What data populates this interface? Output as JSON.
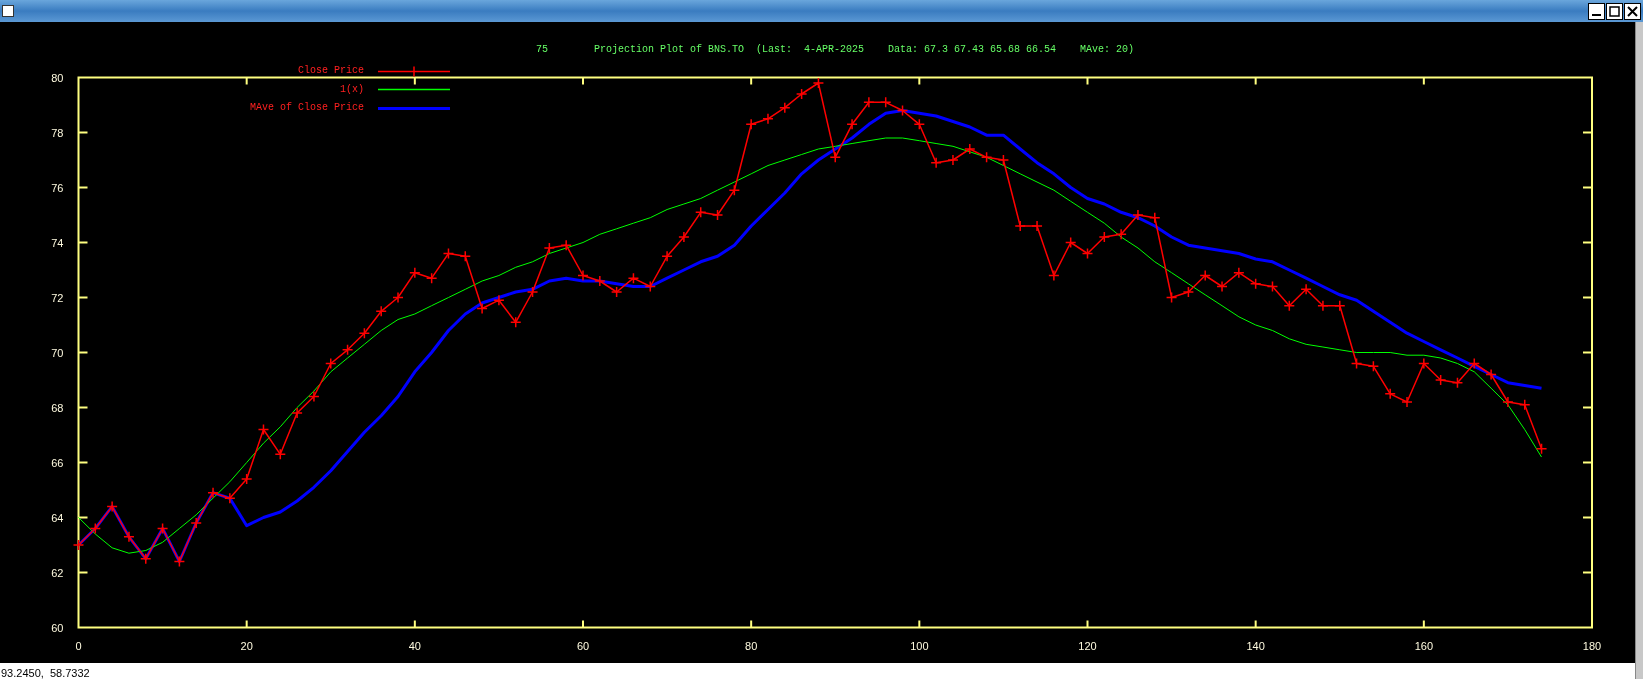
{
  "plot_number": "75",
  "chart_data": {
    "type": "line",
    "title": "Projection Plot of BNS.TO  (Last:  4-APR-2025    Data: 67.3 67.43 65.68 66.54    MAve: 20)",
    "x": [
      0,
      2,
      4,
      6,
      8,
      10,
      12,
      14,
      16,
      18,
      20,
      22,
      24,
      26,
      28,
      30,
      32,
      34,
      36,
      38,
      40,
      42,
      44,
      46,
      48,
      50,
      52,
      54,
      56,
      58,
      60,
      62,
      64,
      66,
      68,
      70,
      72,
      74,
      76,
      78,
      80,
      82,
      84,
      86,
      88,
      90,
      92,
      94,
      96,
      98,
      100,
      102,
      104,
      106,
      108,
      110,
      112,
      114,
      116,
      118,
      120,
      122,
      124,
      126,
      128,
      130,
      132,
      134,
      136,
      138,
      140,
      142,
      144,
      146,
      148,
      150,
      152,
      154,
      156,
      158,
      160,
      162,
      164,
      166,
      168,
      170,
      172,
      174
    ],
    "series": [
      {
        "name": "Close Price",
        "color": "#ff0000",
        "marker": "plus",
        "values": [
          63.0,
          63.6,
          64.4,
          63.3,
          62.5,
          63.6,
          62.4,
          63.8,
          64.9,
          64.7,
          65.4,
          67.2,
          66.3,
          67.8,
          68.4,
          69.6,
          70.1,
          70.7,
          71.5,
          72.0,
          72.9,
          72.7,
          73.6,
          73.5,
          71.6,
          71.9,
          71.1,
          72.2,
          73.8,
          73.9,
          72.8,
          72.6,
          72.2,
          72.7,
          72.4,
          73.5,
          74.2,
          75.1,
          75.0,
          75.9,
          78.3,
          78.5,
          78.9,
          79.4,
          79.8,
          77.1,
          78.3,
          79.1,
          79.1,
          78.8,
          78.3,
          76.9,
          77.0,
          77.4,
          77.1,
          77.0,
          74.6,
          74.6,
          72.8,
          74.0,
          73.6,
          74.2,
          74.3,
          75.0,
          74.9,
          72.0,
          72.2,
          72.8,
          72.4,
          72.9,
          72.5,
          72.4,
          71.7,
          72.3,
          71.7,
          71.7,
          69.6,
          69.5,
          68.5,
          68.2,
          69.6,
          69.0,
          68.9,
          69.6,
          69.2,
          68.2,
          68.1,
          66.5
        ]
      },
      {
        "name": "1(x)",
        "color": "#00ff00",
        "values": [
          64.0,
          63.4,
          62.9,
          62.7,
          62.8,
          63.1,
          63.6,
          64.1,
          64.7,
          65.3,
          66.0,
          66.7,
          67.3,
          68.0,
          68.6,
          69.3,
          69.8,
          70.3,
          70.8,
          71.2,
          71.4,
          71.7,
          72.0,
          72.3,
          72.6,
          72.8,
          73.1,
          73.3,
          73.6,
          73.8,
          74.0,
          74.3,
          74.5,
          74.7,
          74.9,
          75.2,
          75.4,
          75.6,
          75.9,
          76.2,
          76.5,
          76.8,
          77.0,
          77.2,
          77.4,
          77.5,
          77.6,
          77.7,
          77.8,
          77.8,
          77.7,
          77.6,
          77.5,
          77.3,
          77.1,
          76.8,
          76.5,
          76.2,
          75.9,
          75.5,
          75.1,
          74.7,
          74.2,
          73.8,
          73.3,
          72.9,
          72.5,
          72.1,
          71.7,
          71.3,
          71.0,
          70.8,
          70.5,
          70.3,
          70.2,
          70.1,
          70.0,
          70.0,
          70.0,
          69.9,
          69.9,
          69.8,
          69.6,
          69.3,
          68.7,
          68.1,
          67.2,
          66.2
        ]
      },
      {
        "name": "MAve of Close Price",
        "color": "#0000ff",
        "values": [
          63.0,
          63.6,
          64.4,
          63.3,
          62.5,
          63.6,
          62.4,
          63.8,
          64.9,
          64.7,
          63.7,
          64.0,
          64.2,
          64.6,
          65.1,
          65.7,
          66.4,
          67.1,
          67.7,
          68.4,
          69.3,
          70.0,
          70.8,
          71.4,
          71.8,
          72.0,
          72.2,
          72.3,
          72.6,
          72.7,
          72.6,
          72.6,
          72.5,
          72.4,
          72.4,
          72.7,
          73.0,
          73.3,
          73.5,
          73.9,
          74.6,
          75.2,
          75.8,
          76.5,
          77.0,
          77.4,
          77.8,
          78.3,
          78.7,
          78.8,
          78.7,
          78.6,
          78.4,
          78.2,
          77.9,
          77.9,
          77.4,
          76.9,
          76.5,
          76.0,
          75.6,
          75.4,
          75.1,
          74.9,
          74.6,
          74.2,
          73.9,
          73.8,
          73.7,
          73.6,
          73.4,
          73.3,
          73.0,
          72.7,
          72.4,
          72.1,
          71.9,
          71.5,
          71.1,
          70.7,
          70.4,
          70.1,
          69.8,
          69.5,
          69.2,
          68.9,
          68.8,
          68.7
        ]
      }
    ],
    "xlim": [
      0,
      180
    ],
    "ylim": [
      60,
      80
    ],
    "xticks": [
      0,
      20,
      40,
      60,
      80,
      100,
      120,
      140,
      160,
      180
    ],
    "yticks": [
      60,
      62,
      64,
      66,
      68,
      70,
      72,
      74,
      76,
      78,
      80
    ]
  },
  "status_bar": "93.2450,  58.7332"
}
